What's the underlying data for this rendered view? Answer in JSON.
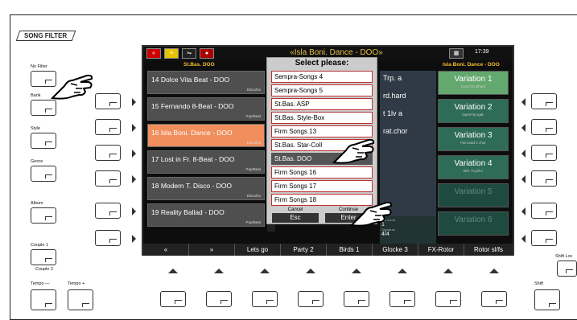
{
  "panel": {
    "song_filter": "SONG FILTER",
    "left_labels": {
      "no_filter": "No Filter",
      "bank": "Bank",
      "style": "Style",
      "genre": "Genre",
      "album": "Album",
      "couple1": "Couple 1",
      "couple2": "Couple 2",
      "tempo_minus": "Tempo —",
      "tempo_plus": "Tempo +"
    },
    "right_labels": {
      "shift_lock": "Shift Loc",
      "shift": "Shift"
    }
  },
  "screen": {
    "title": "«Isla Boni. Dance - DOO»",
    "time": "17:39",
    "left_header": "St.Bas. DOO",
    "right_header": "Isla Boni. Dance - DOO",
    "songs": [
      {
        "name": "14 Dolce Vita Beat - DOO",
        "tag": "Discofox"
      },
      {
        "name": "15 Fernando 8-Beat - DOO",
        "tag": "Pop/Beat"
      },
      {
        "name": "16 Isla Boni. Dance - DOO",
        "tag": "Discofox"
      },
      {
        "name": "17 Lost in Fr. 8-Beat - DOO",
        "tag": "Pop/Beat"
      },
      {
        "name": "18 Modern T. Disco - DOO",
        "tag": "Discofox"
      },
      {
        "name": "19 Reality Ballad - DOO",
        "tag": "Pop/Beat"
      }
    ],
    "right_items": [
      "Trp. a",
      "rd.hard",
      "t 1lv  a",
      "rat.chor"
    ],
    "variations": [
      {
        "name": "Variation 1",
        "sub": "ConcGt.ndhard"
      },
      {
        "name": "Variation 2",
        "sub": "OpenTrp.Igat."
      },
      {
        "name": "Variation 3",
        "sub": "Fat Lead 2 chor"
      },
      {
        "name": "Variation 4",
        "sub": "Brit. Tr.pill.V"
      },
      {
        "name": "Variation 5",
        "sub": ""
      },
      {
        "name": "Variation 6",
        "sub": ""
      }
    ],
    "info": {
      "count_label": "Bar count",
      "count": "1",
      "sig_label": "Signature",
      "sig": "4/4"
    },
    "dialog": {
      "title": "Select please:",
      "options": [
        "Sempra-Songs 4",
        "Sempra-Songs 5",
        "St.Bas. ASP",
        "St.Bas. Style-Box",
        "Firm Songs 13",
        "St.Bas. Star-Coll",
        "St.Bas. DOO",
        "Firm Songs 16",
        "Firm Songs 17",
        "Firm Songs 18"
      ],
      "cancel_caption": "Cancel",
      "cancel_key": "Esc",
      "continue_caption": "Continue",
      "continue_key": "Enter"
    },
    "bottom": {
      "up": "«",
      "down": "»",
      "b1": "Lets go",
      "b2": "Party 2",
      "b3": "Birds 1",
      "b4": "Glocke 3",
      "b5": "FX-Rotor",
      "b6": "Rotor sl/fs"
    }
  }
}
